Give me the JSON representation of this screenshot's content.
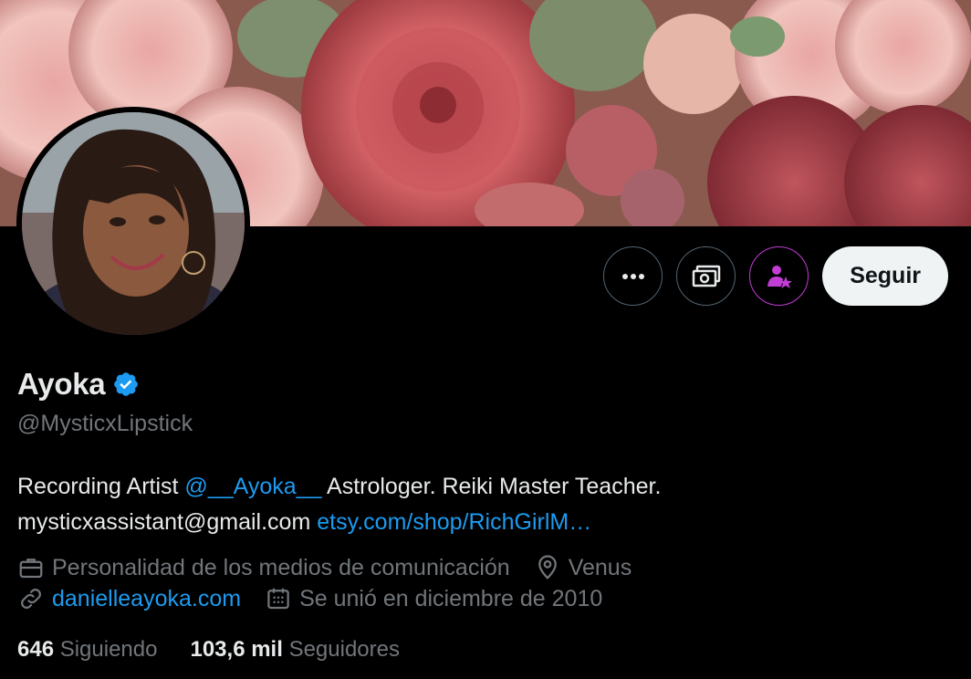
{
  "profile": {
    "name": "Ayoka",
    "verified": true,
    "handle": "@MysticxLipstick",
    "bio": {
      "text1": "Recording Artist ",
      "mention": "@__Ayoka__",
      "text2": " Astrologer. Reiki Master Teacher.",
      "email": "mysticxassistant@gmail.com ",
      "url": "etsy.com/shop/RichGirlM…"
    },
    "category": "Personalidad de los medios de comunicación",
    "location": "Venus",
    "website": "danielleayoka.com",
    "joined": "Se unió en diciembre de 2010"
  },
  "actions": {
    "more_icon": "more-icon",
    "tip_icon": "money-icon",
    "subscribe_icon": "subscribe-star-icon",
    "follow_label": "Seguir"
  },
  "stats": {
    "following_count": "646",
    "following_label": "Siguiendo",
    "followers_count": "103,6 mil",
    "followers_label": "Seguidores"
  },
  "colors": {
    "accent": "#1d9bf0",
    "muted": "#71767b",
    "text": "#e7e9ea",
    "subscribe": "#c13dd3",
    "background": "#000000"
  }
}
